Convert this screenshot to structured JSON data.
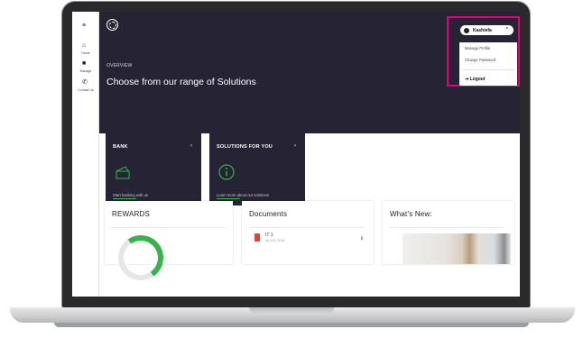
{
  "sidebar": {
    "menu_icon": "hamburger-menu-icon",
    "items": [
      {
        "label": "Home",
        "icon": "home-icon"
      },
      {
        "label": "Manage",
        "icon": "briefcase-icon"
      },
      {
        "label": "Contact Us",
        "icon": "phone-icon"
      }
    ]
  },
  "hero": {
    "logo_icon": "brand-logo-icon",
    "overline": "OVERVIEW",
    "title": "Choose from our range of Solutions"
  },
  "user_menu": {
    "username": "Kashiefa",
    "items": [
      "Manage Profile",
      "Change Password"
    ],
    "logout": "Logout",
    "highlight_color": "#e3007b"
  },
  "cards": [
    {
      "title": "BANK",
      "footer": "Start banking with us",
      "icon": "card-icon"
    },
    {
      "title": "SOLUTIONS FOR YOU",
      "footer": "Learn more about our solutions",
      "icon": "info-icon"
    }
  ],
  "panels": {
    "rewards": {
      "title": "REWARDS"
    },
    "documents": {
      "title": "Documents",
      "item_name": "IT 1",
      "item_date": "06 JUL 2018",
      "item_icon": "pdf-icon",
      "action_icon": "download-icon"
    },
    "whats_new": {
      "title": "What's New:"
    }
  },
  "colors": {
    "hero_bg": "#262334",
    "accent_green": "#35b449"
  }
}
